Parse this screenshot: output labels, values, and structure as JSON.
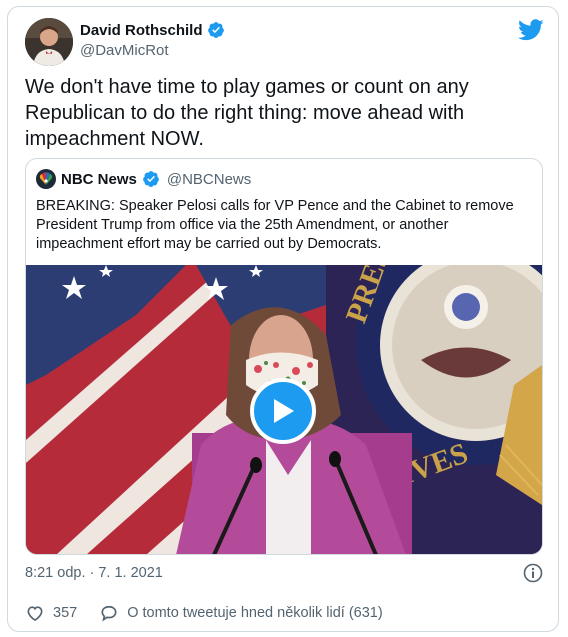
{
  "author": {
    "name": "David Rothschild",
    "handle": "@DavMicRot",
    "verified": true
  },
  "tweet": {
    "text": "We don't have time to play games or count on any Republican to do the right thing: move ahead with impeachment NOW."
  },
  "quoted": {
    "name": "NBC News",
    "handle": "@NBCNews",
    "verified": true,
    "text": "BREAKING: Speaker Pelosi calls for VP Pence and the Cabinet to remove President Trump from office via the 25th Amendment, or another impeachment effort may be carried out by Democrats."
  },
  "meta": {
    "timestamp": "8:21 odp. · 7. 1. 2021"
  },
  "actions": {
    "likes": "357",
    "conversation": "O tomto tweetuje hned několik lidí (631)"
  },
  "colors": {
    "accent": "#1d9bf0",
    "text": "#0f1419",
    "muted": "#536471",
    "border": "#cfd9de"
  },
  "icons": [
    "twitter-bird-icon",
    "verified-badge-icon",
    "play-icon",
    "info-icon",
    "heart-icon",
    "speech-bubble-icon"
  ]
}
